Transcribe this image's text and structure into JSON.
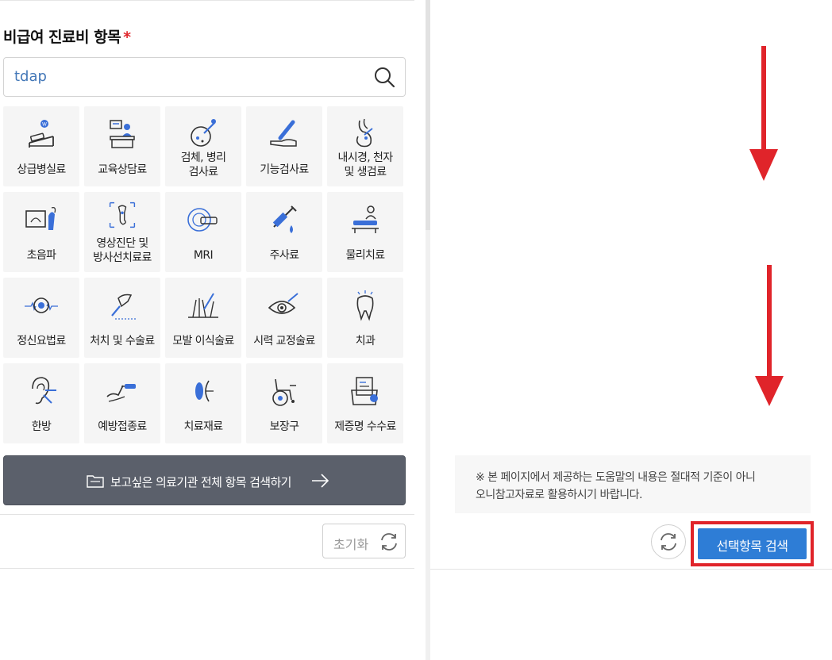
{
  "section": {
    "title": "비급여 진료비 항목",
    "required_mark": "*"
  },
  "search": {
    "value": "tdap",
    "icon": "search-icon"
  },
  "categories": [
    {
      "label": "상급병실료",
      "icon": "hospital-bed-icon"
    },
    {
      "label": "교육상담료",
      "icon": "counseling-desk-icon"
    },
    {
      "label": "검체, 병리\n검사료",
      "icon": "specimen-test-icon"
    },
    {
      "label": "기능검사료",
      "icon": "thermometer-hand-icon"
    },
    {
      "label": "내시경, 천자\n및 생검료",
      "icon": "endoscope-stomach-icon"
    },
    {
      "label": "초음파",
      "icon": "ultrasound-icon"
    },
    {
      "label": "영상진단 및\n방사선치료료",
      "icon": "xray-bone-icon"
    },
    {
      "label": "MRI",
      "icon": "mri-icon"
    },
    {
      "label": "주사료",
      "icon": "syringe-icon"
    },
    {
      "label": "물리치료",
      "icon": "physical-therapy-icon"
    },
    {
      "label": "정신요법료",
      "icon": "brain-wave-icon"
    },
    {
      "label": "처치 및 수술료",
      "icon": "scalpel-hand-icon"
    },
    {
      "label": "모발 이식술료",
      "icon": "hair-transplant-icon"
    },
    {
      "label": "시력 교정술료",
      "icon": "eye-laser-icon"
    },
    {
      "label": "치과",
      "icon": "tooth-icon"
    },
    {
      "label": "한방",
      "icon": "ear-acupuncture-icon"
    },
    {
      "label": "예방접종료",
      "icon": "arm-injection-icon"
    },
    {
      "label": "치료재료",
      "icon": "lens-material-icon"
    },
    {
      "label": "보장구",
      "icon": "wheelchair-icon"
    },
    {
      "label": "제증명 수수료",
      "icon": "certificate-folder-icon"
    }
  ],
  "all_search": {
    "label": "보고싶은 의료기관 전체 항목 검색하기",
    "icon": "folder-icon",
    "arrow": "arrow-right-icon"
  },
  "reset": {
    "label": "초기화",
    "icon": "refresh-icon"
  },
  "notice": {
    "text": "※ 본 페이지에서 제공하는 도움말의 내용은 절대적 기준이 아니\n오니참고자료로 활용하시기 바랍니다."
  },
  "actions": {
    "search_label": "선택항목 검색",
    "refresh_icon": "refresh-icon"
  },
  "colors": {
    "accent_blue": "#2e7dd6",
    "highlight_red": "#e0242a",
    "dark_button": "#5b606b",
    "icon_blue": "#3a6fd8"
  }
}
